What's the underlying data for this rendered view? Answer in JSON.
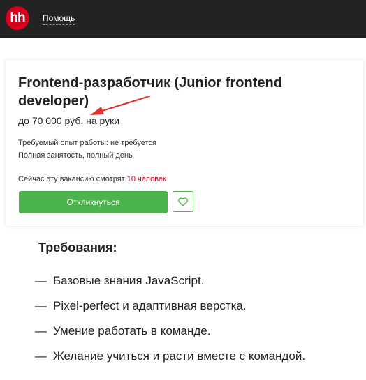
{
  "header": {
    "logo_text": "hh",
    "help_link": "Помощь",
    "colors": {
      "background": "#232323",
      "logo": "#d6001c"
    }
  },
  "vacancy": {
    "title": "Frontend-разработчик (Junior frontend developer)",
    "salary": "до 70 000 руб. на руки",
    "experience": "Требуемый опыт работы: не требуется",
    "employment": "Полная занятость, полный день",
    "viewers_prefix": "Сейчас эту вакансию смотрят",
    "viewers_count": "10 человек",
    "apply_label": "Откликнуться",
    "favorite_icon": "heart-icon",
    "colors": {
      "accent": "#4bb34b",
      "highlight": "#d6001c"
    }
  },
  "requirements": {
    "title": "Требования:",
    "dash": "—",
    "items": [
      "Базовые знания JavaScript.",
      "Pixel-perfect и адаптивная верстка.",
      "Умение работать в команде.",
      "Желание учиться и расти вместе с командой."
    ]
  }
}
